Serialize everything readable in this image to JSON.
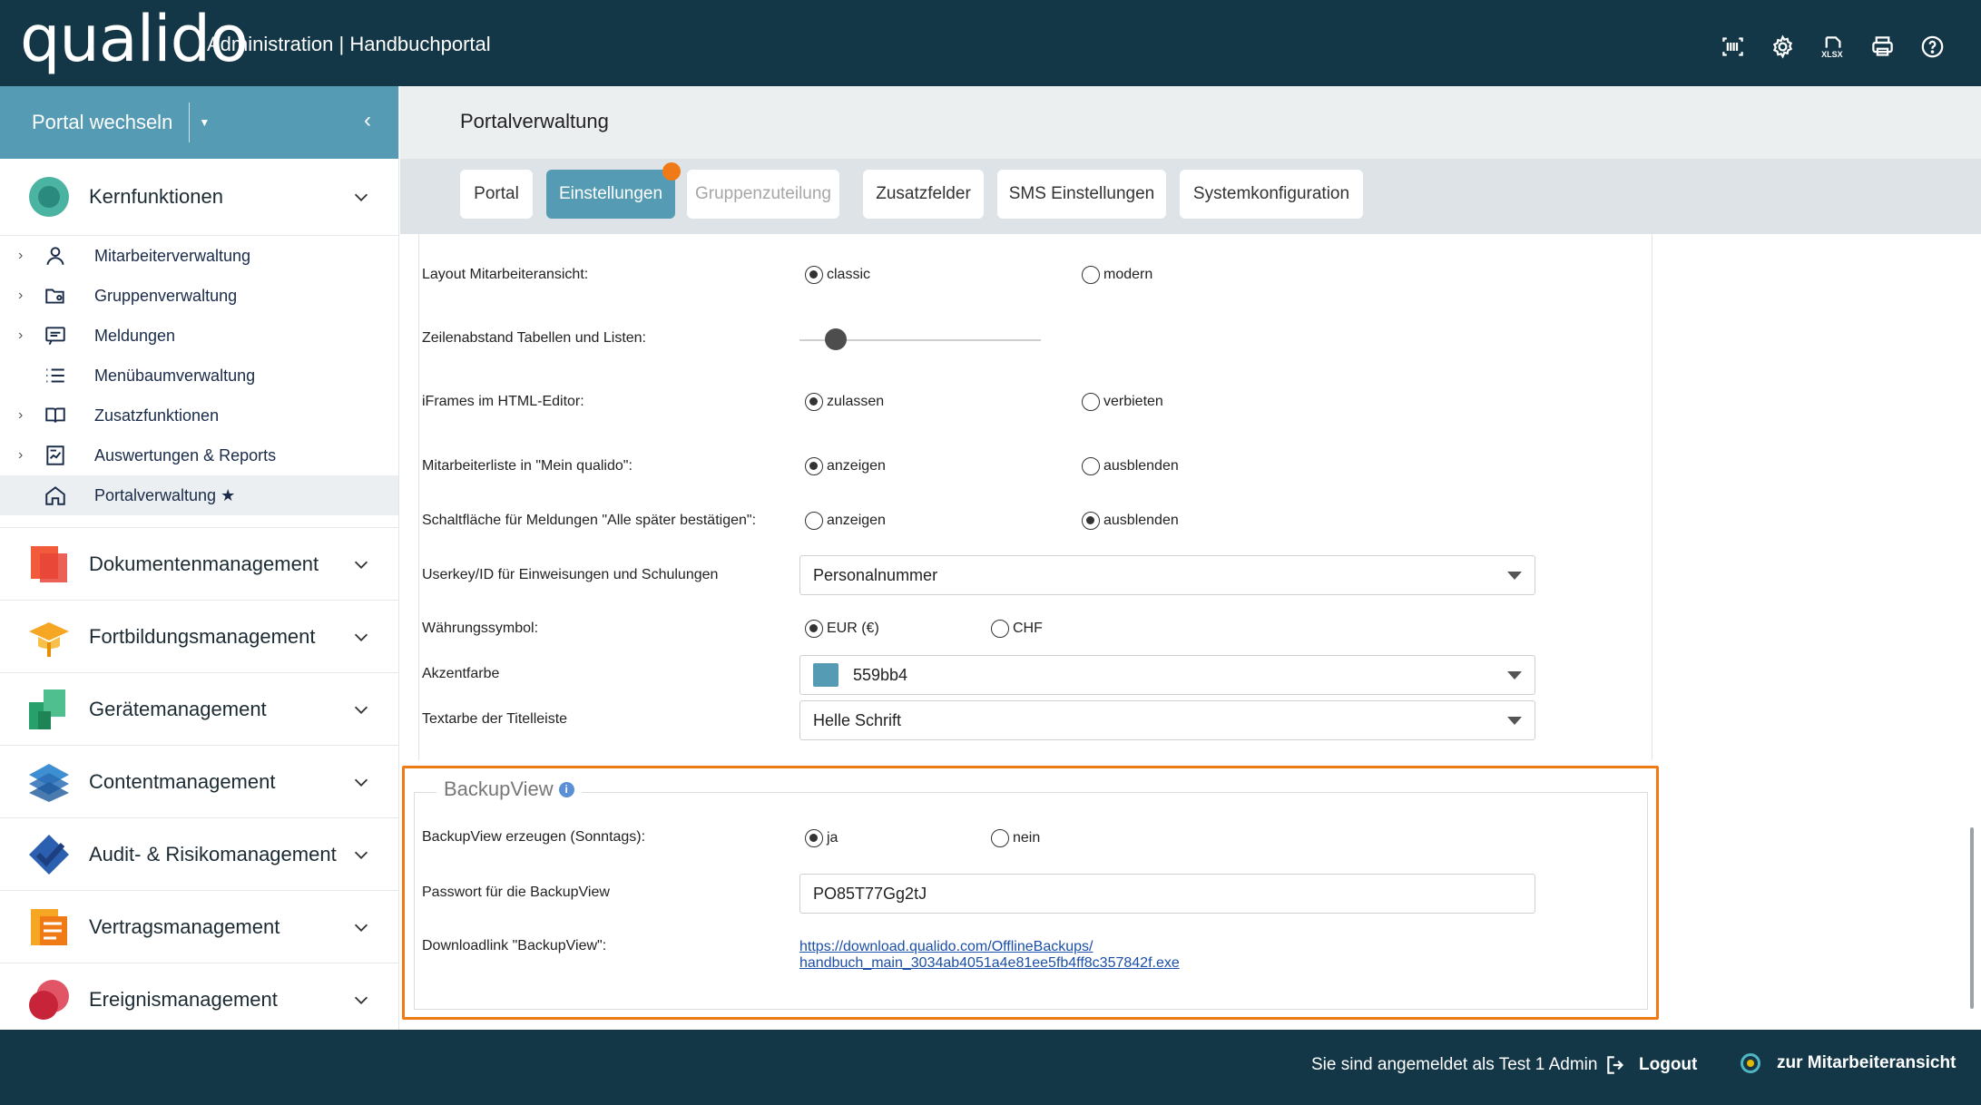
{
  "header": {
    "logo": "qualido",
    "title": "Administration | Handbuchportal",
    "icons": [
      "barcode-scan-icon",
      "gear-icon",
      "xlsx-icon",
      "printer-icon",
      "help-icon"
    ],
    "xlsx_text": "XLSX"
  },
  "sidebar": {
    "portal_switch": "Portal wechseln",
    "kern": "Kernfunktionen",
    "subitems": [
      {
        "label": "Mitarbeiterverwaltung",
        "icon": "person-icon"
      },
      {
        "label": "Gruppenverwaltung",
        "icon": "group-folder-icon"
      },
      {
        "label": "Meldungen",
        "icon": "message-icon"
      },
      {
        "label": "Menübaumverwaltung",
        "icon": "list-icon"
      },
      {
        "label": "Zusatzfunktionen",
        "icon": "book-icon"
      },
      {
        "label": "Auswertungen & Reports",
        "icon": "report-icon"
      },
      {
        "label": "Portalverwaltung ★",
        "icon": "home-icon"
      }
    ],
    "groups": [
      {
        "label": "Dokumentenmanagement"
      },
      {
        "label": "Fortbildungsmanagement"
      },
      {
        "label": "Gerätemanagement"
      },
      {
        "label": "Contentmanagement"
      },
      {
        "label": "Audit- & Risikomanagement"
      },
      {
        "label": "Vertragsmanagement"
      },
      {
        "label": "Ereignismanagement"
      }
    ]
  },
  "main": {
    "title": "Portalverwaltung",
    "tabs": [
      "Portal",
      "Einstellungen",
      "Gruppenzuteilung",
      "Zusatzfelder",
      "SMS Einstellungen",
      "Systemkonfiguration"
    ],
    "active_tab": "Einstellungen"
  },
  "settings": {
    "layout_label": "Layout Mitarbeiteransicht:",
    "layout_opt1": "classic",
    "layout_opt2": "modern",
    "spacing_label": "Zeilenabstand Tabellen und Listen:",
    "spacing_level": 0.15,
    "iframes_label": "iFrames im HTML-Editor:",
    "iframes_opt1": "zulassen",
    "iframes_opt2": "verbieten",
    "mlist_label": "Mitarbeiterliste in \"Mein qualido\":",
    "mlist_opt1": "anzeigen",
    "mlist_opt2": "ausblenden",
    "button_label": "Schaltfläche für Meldungen \"Alle später bestätigen\":",
    "button_opt1": "anzeigen",
    "button_opt2": "ausblenden",
    "userkey_label": "Userkey/ID für Einweisungen und Schulungen",
    "userkey_value": "Personalnummer",
    "currency_label": "Währungssymbol:",
    "currency_opt1": "EUR (€)",
    "currency_opt2": "CHF",
    "accent_label": "Akzentfarbe",
    "accent_value": "559bb4",
    "accent_color": "#559bb4",
    "titlebar_label": "Textarbe der Titelleiste",
    "titlebar_value": "Helle Schrift"
  },
  "backup": {
    "legend": "BackupView",
    "info": "i",
    "create_label": "BackupView erzeugen (Sonntags):",
    "create_opt1": "ja",
    "create_opt2": "nein",
    "password_label": "Passwort für die BackupView",
    "password_value": "PO85T77Gg2tJ",
    "download_label": "Downloadlink \"BackupView\":",
    "download_line1": "https://download.qualido.com/OfflineBackups/",
    "download_line2": "handbuch_main_3034ab4051a4e81ee5fb4ff8c357842f.exe"
  },
  "footer": {
    "login_prefix": "Sie sind angemeldet als",
    "login_user": "Test 1 Admin",
    "logout": "Logout",
    "employee_view": "zur Mitarbeiteransicht"
  },
  "colors": {
    "header_bg": "#143747",
    "accent": "#559bb4",
    "highlight": "#f07b16"
  }
}
